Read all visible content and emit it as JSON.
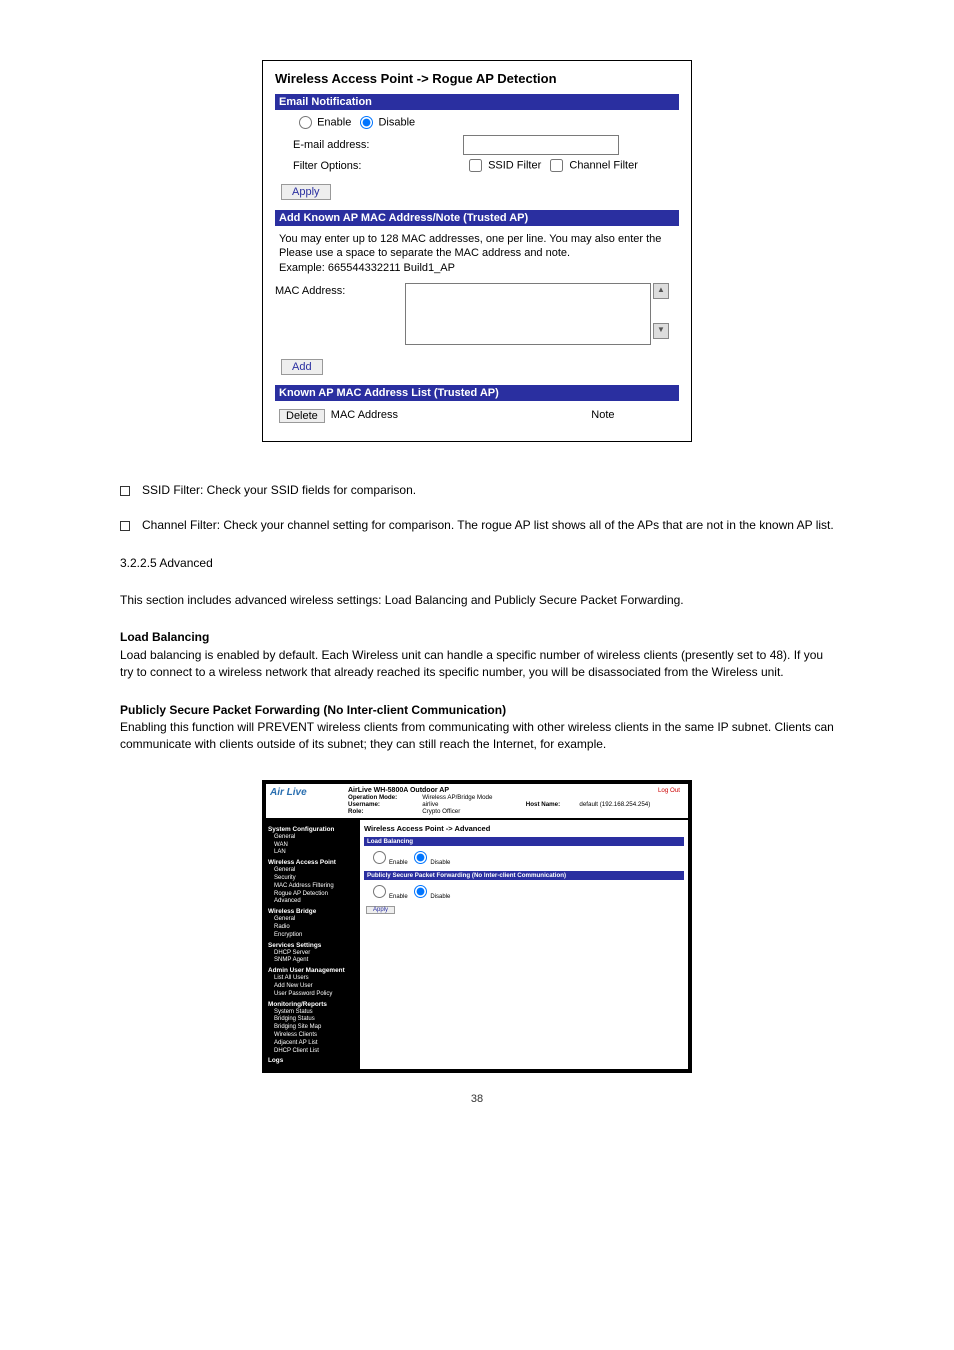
{
  "panel1": {
    "breadcrumb": "Wireless Access Point -> Rogue AP Detection",
    "section_email": "Email Notification",
    "enable": "Enable",
    "disable": "Disable",
    "email_label": "E-mail address:",
    "filter_label": "Filter Options:",
    "ssid_filter": "SSID Filter",
    "channel_filter": "Channel Filter",
    "apply": "Apply",
    "section_add": "Add Known AP MAC Address/Note (Trusted AP)",
    "add_note_line1": "You may enter up to 128 MAC addresses, one per line. You may also enter the",
    "add_note_line2": "Please use a space to separate the MAC address and note.",
    "add_note_line3": "Example: 665544332211 Build1_AP",
    "mac_label": "MAC Address:",
    "add": "Add",
    "section_list": "Known AP MAC Address List (Trusted AP)",
    "delete": "Delete",
    "col_mac": "MAC Address",
    "col_note": "Note"
  },
  "bodytext": {
    "b1": "SSID Filter: Check your SSID fields for comparison.",
    "b2": "Channel Filter: Check your channel setting for comparison. The rogue AP list shows all of the APs that are not in the known AP list.",
    "h3": "3.2.2.5 Advanced",
    "p1": "This section includes advanced wireless settings: Load Balancing and Publicly Secure Packet Forwarding.",
    "lb_t": "Load Balancing",
    "lb_b": "Load balancing is enabled by default. Each Wireless unit can handle a specific number of wireless clients (presently set to 48). If you try to connect to a wireless network that already reached its specific number, you will be disassociated from the Wireless unit.",
    "ps_t": "Publicly Secure Packet Forwarding (No Inter-client Communication)",
    "ps_b": "Enabling this function will PREVENT wireless clients from communicating with other wireless clients in the same IP subnet. Clients can communicate with clients outside of its subnet; they can still reach the Internet, for example."
  },
  "panel2": {
    "product": "AirLive WH-5800A  Outdoor AP",
    "logout": "Log Out",
    "opmode_l": "Operation Mode:",
    "opmode_v": "Wireless AP/Bridge Mode",
    "user_l": "Username:",
    "user_v": "airlive",
    "host_l": "Host Name:",
    "host_v": "default (192.168.254.254)",
    "role_l": "Role:",
    "role_v": "Crypto Officer",
    "bc": "Wireless Access Point -> Advanced",
    "hdr1": "Load Balancing",
    "hdr2": "Publicly Secure Packet Forwarding (No Inter-client Communication)",
    "enable": "Enable",
    "disable": "Disable",
    "apply": "Apply",
    "nav": {
      "g1": "System Configuration",
      "g1i": [
        "General",
        "WAN",
        "LAN"
      ],
      "g2": "Wireless Access Point",
      "g2i": [
        "General",
        "Security",
        "MAC Address Filtering",
        "Rogue AP Detection",
        "Advanced"
      ],
      "g3": "Wireless Bridge",
      "g3i": [
        "General",
        "Radio",
        "Encryption"
      ],
      "g4": "Services Settings",
      "g4i": [
        "DHCP Server",
        "SNMP Agent"
      ],
      "g5": "Admin User Management",
      "g5i": [
        "List All Users",
        "Add New User",
        "User Password Policy"
      ],
      "g6": "Monitoring/Reports",
      "g6i": [
        "System Status",
        "Bridging Status",
        "Bridging Site Map",
        "Wireless Clients",
        "Adjacent AP List",
        "DHCP Client List"
      ],
      "g7": "Logs"
    }
  },
  "page_num": "38"
}
